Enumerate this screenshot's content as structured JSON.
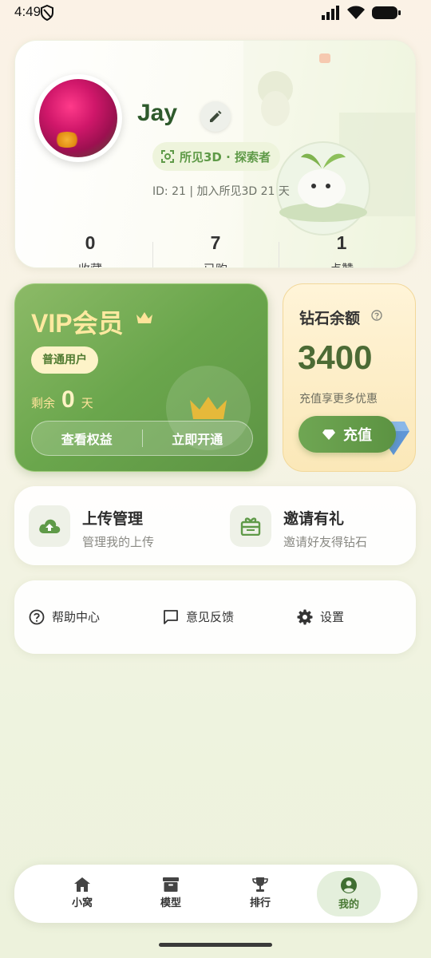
{
  "status_bar": {
    "time": "4:49"
  },
  "profile": {
    "name": "Jay",
    "title_badge": "所见3D · 探索者",
    "meta": "ID: 21  |  加入所见3D 21 天",
    "stats": [
      {
        "value": "0",
        "label": "收藏"
      },
      {
        "value": "7",
        "label": "已购"
      },
      {
        "value": "1",
        "label": "点赞"
      }
    ]
  },
  "vip": {
    "title": "VIP会员",
    "level": "普通用户",
    "remain_prefix": "剩余",
    "remain_days": "0",
    "remain_suffix": "天",
    "view_benefits": "查看权益",
    "open_now": "立即开通"
  },
  "diamond": {
    "title": "钻石余额",
    "amount": "3400",
    "promo": "充值享更多优惠",
    "recharge": "充值"
  },
  "actions": [
    {
      "title": "上传管理",
      "subtitle": "管理我的上传",
      "icon": "cloud-upload-icon"
    },
    {
      "title": "邀请有礼",
      "subtitle": "邀请好友得钻石",
      "icon": "gift-icon"
    }
  ],
  "menu": [
    {
      "label": "帮助中心",
      "icon": "help-icon"
    },
    {
      "label": "意见反馈",
      "icon": "feedback-icon"
    },
    {
      "label": "设置",
      "icon": "gear-icon"
    }
  ],
  "nav": [
    {
      "label": "小窝",
      "icon": "home-icon"
    },
    {
      "label": "模型",
      "icon": "box-icon"
    },
    {
      "label": "排行",
      "icon": "trophy-icon"
    },
    {
      "label": "我的",
      "icon": "user-icon",
      "active": true
    }
  ],
  "colors": {
    "primary_green": "#6aa64c",
    "gold": "#ffe9a0",
    "dark_green_text": "#2e5a2c"
  }
}
